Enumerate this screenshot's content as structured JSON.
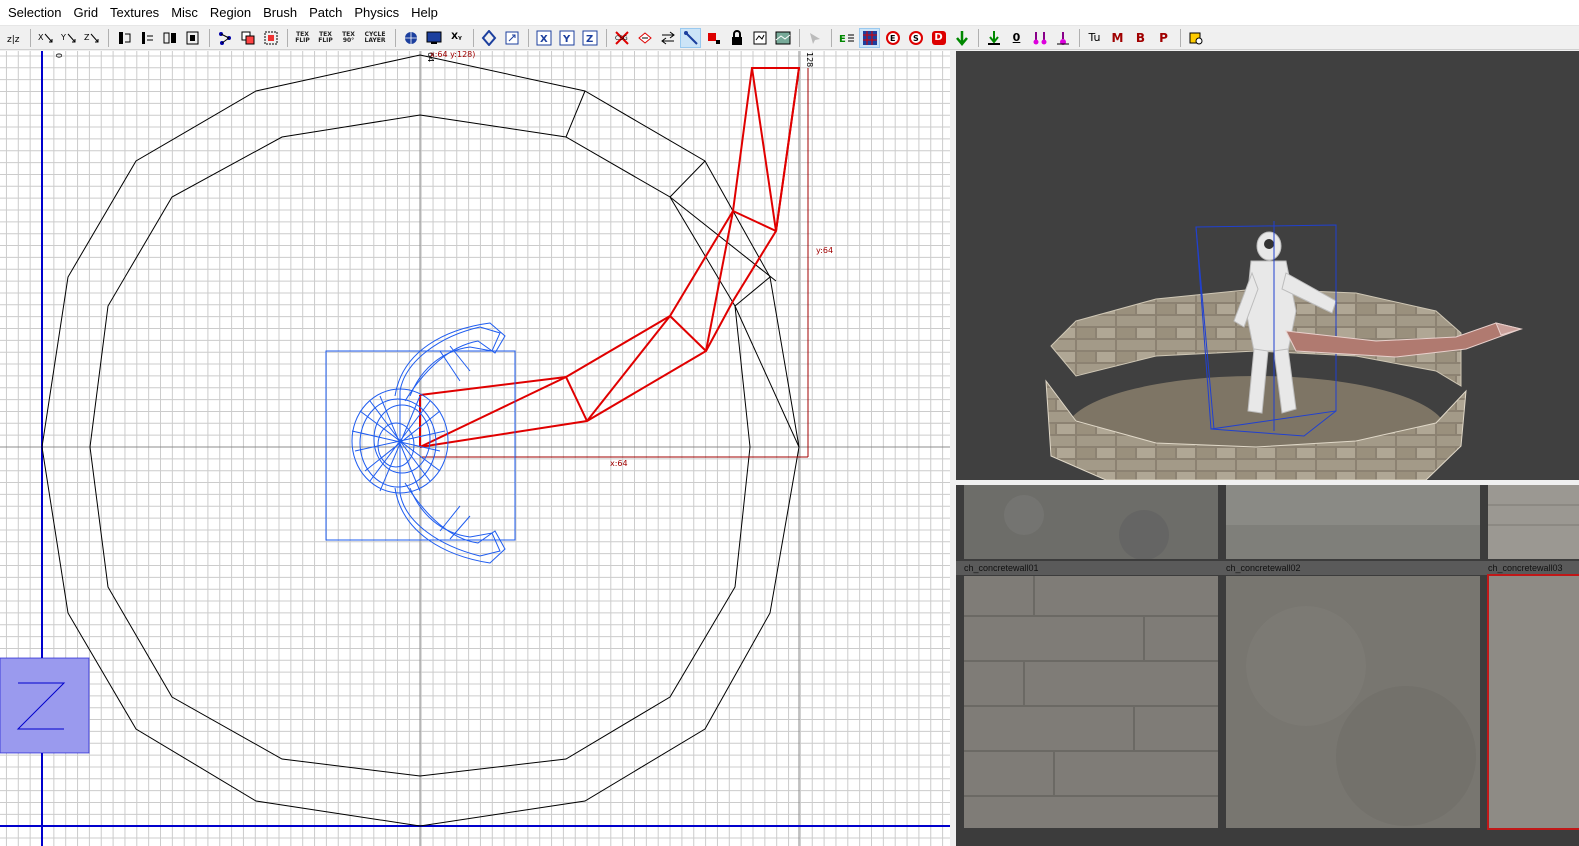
{
  "menu": [
    "Selection",
    "Grid",
    "Textures",
    "Misc",
    "Region",
    "Brush",
    "Patch",
    "Physics",
    "Help"
  ],
  "toolbar": {
    "flip_text": "TEX\nFLIP",
    "flip2_text": "TEX\nFLIP",
    "rot_text": "TEX\n90°",
    "cycle_text": "CYCLE\nLAYER",
    "xy_text": "Xᵧ",
    "x_text": "X",
    "y_text": "Y",
    "z_text": "Z",
    "tu_text": "Tu",
    "m_text": "M",
    "b_text": "B",
    "p_text": "P",
    "d_text": "D",
    "zero_text": "0",
    "ecolor": "#008000"
  },
  "grid_view": {
    "ruler_x": [
      "0",
      "128"
    ],
    "ruler_top_label": "x:64  y:128)",
    "dim_x_label": "x:64",
    "dim_y_label": "y:64",
    "ruler_mid": "64"
  },
  "texture_browser": {
    "textures": [
      "ch_concretewall01",
      "ch_concretewall02",
      "ch_concretewall03"
    ]
  },
  "colors": {
    "grid_minor": "#cccccc",
    "grid_axis": "#0000cc",
    "brush": "#000000",
    "selected": "#e00000",
    "model": "#1e5cf0",
    "camera_bg": "#404040"
  }
}
